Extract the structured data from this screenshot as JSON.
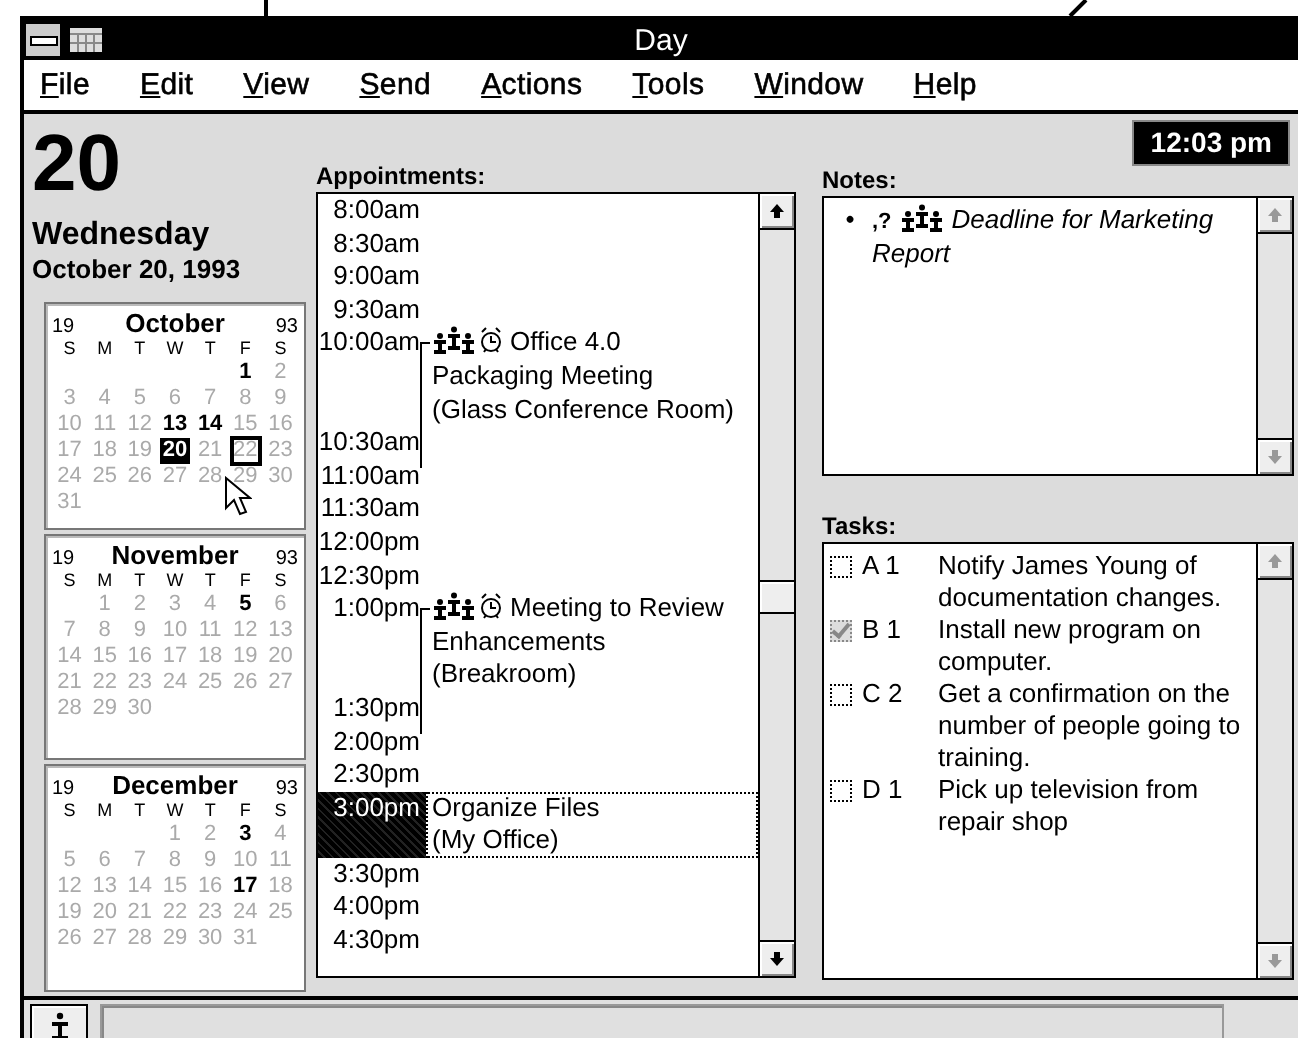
{
  "window": {
    "title": "Day"
  },
  "menu": [
    {
      "label": "File"
    },
    {
      "label": "Edit"
    },
    {
      "label": "View"
    },
    {
      "label": "Send"
    },
    {
      "label": "Actions"
    },
    {
      "label": "Tools"
    },
    {
      "label": "Window"
    },
    {
      "label": "Help"
    }
  ],
  "date": {
    "day": "20",
    "weekday": "Wednesday",
    "full": "October 20, 1993"
  },
  "clock": "12:03 pm",
  "calendars": [
    {
      "century": "19",
      "month": "October",
      "year": "93",
      "weekdays": [
        "S",
        "M",
        "T",
        "W",
        "T",
        "F",
        "S"
      ],
      "days": [
        {
          "kind": "blank"
        },
        {
          "kind": "blank"
        },
        {
          "kind": "blank"
        },
        {
          "kind": "blank"
        },
        {
          "kind": "blank"
        },
        {
          "kind": "day",
          "day": "1",
          "bold": true,
          "selected": false,
          "focused": false
        },
        {
          "kind": "day",
          "day": "2",
          "bold": false,
          "selected": false,
          "focused": false
        },
        {
          "kind": "day",
          "day": "3",
          "bold": false,
          "selected": false,
          "focused": false
        },
        {
          "kind": "day",
          "day": "4",
          "bold": false,
          "selected": false,
          "focused": false
        },
        {
          "kind": "day",
          "day": "5",
          "bold": false,
          "selected": false,
          "focused": false
        },
        {
          "kind": "day",
          "day": "6",
          "bold": false,
          "selected": false,
          "focused": false
        },
        {
          "kind": "day",
          "day": "7",
          "bold": false,
          "selected": false,
          "focused": false
        },
        {
          "kind": "day",
          "day": "8",
          "bold": false,
          "selected": false,
          "focused": false
        },
        {
          "kind": "day",
          "day": "9",
          "bold": false,
          "selected": false,
          "focused": false
        },
        {
          "kind": "day",
          "day": "10",
          "bold": false,
          "selected": false,
          "focused": false
        },
        {
          "kind": "day",
          "day": "11",
          "bold": false,
          "selected": false,
          "focused": false
        },
        {
          "kind": "day",
          "day": "12",
          "bold": false,
          "selected": false,
          "focused": false
        },
        {
          "kind": "day",
          "day": "13",
          "bold": true,
          "selected": false,
          "focused": false
        },
        {
          "kind": "day",
          "day": "14",
          "bold": true,
          "selected": false,
          "focused": false
        },
        {
          "kind": "day",
          "day": "15",
          "bold": false,
          "selected": false,
          "focused": false
        },
        {
          "kind": "day",
          "day": "16",
          "bold": false,
          "selected": false,
          "focused": false
        },
        {
          "kind": "day",
          "day": "17",
          "bold": false,
          "selected": false,
          "focused": false
        },
        {
          "kind": "day",
          "day": "18",
          "bold": false,
          "selected": false,
          "focused": false
        },
        {
          "kind": "day",
          "day": "19",
          "bold": false,
          "selected": false,
          "focused": false
        },
        {
          "kind": "day",
          "day": "20",
          "bold": true,
          "selected": true,
          "focused": false
        },
        {
          "kind": "day",
          "day": "21",
          "bold": false,
          "selected": false,
          "focused": false
        },
        {
          "kind": "day",
          "day": "22",
          "bold": false,
          "selected": false,
          "focused": true
        },
        {
          "kind": "day",
          "day": "23",
          "bold": false,
          "selected": false,
          "focused": false
        },
        {
          "kind": "day",
          "day": "24",
          "bold": false,
          "selected": false,
          "focused": false
        },
        {
          "kind": "day",
          "day": "25",
          "bold": false,
          "selected": false,
          "focused": false
        },
        {
          "kind": "day",
          "day": "26",
          "bold": false,
          "selected": false,
          "focused": false
        },
        {
          "kind": "day",
          "day": "27",
          "bold": false,
          "selected": false,
          "focused": false
        },
        {
          "kind": "day",
          "day": "28",
          "bold": false,
          "selected": false,
          "focused": false
        },
        {
          "kind": "day",
          "day": "29",
          "bold": false,
          "selected": false,
          "focused": false
        },
        {
          "kind": "day",
          "day": "30",
          "bold": false,
          "selected": false,
          "focused": false
        },
        {
          "kind": "day",
          "day": "31",
          "bold": false,
          "selected": false,
          "focused": false
        }
      ]
    },
    {
      "century": "19",
      "month": "November",
      "year": "93",
      "weekdays": [
        "S",
        "M",
        "T",
        "W",
        "T",
        "F",
        "S"
      ],
      "days": [
        {
          "kind": "blank"
        },
        {
          "kind": "day",
          "day": "1",
          "bold": false,
          "selected": false,
          "focused": false
        },
        {
          "kind": "day",
          "day": "2",
          "bold": false,
          "selected": false,
          "focused": false
        },
        {
          "kind": "day",
          "day": "3",
          "bold": false,
          "selected": false,
          "focused": false
        },
        {
          "kind": "day",
          "day": "4",
          "bold": false,
          "selected": false,
          "focused": false
        },
        {
          "kind": "day",
          "day": "5",
          "bold": true,
          "selected": false,
          "focused": false
        },
        {
          "kind": "day",
          "day": "6",
          "bold": false,
          "selected": false,
          "focused": false
        },
        {
          "kind": "day",
          "day": "7",
          "bold": false,
          "selected": false,
          "focused": false
        },
        {
          "kind": "day",
          "day": "8",
          "bold": false,
          "selected": false,
          "focused": false
        },
        {
          "kind": "day",
          "day": "9",
          "bold": false,
          "selected": false,
          "focused": false
        },
        {
          "kind": "day",
          "day": "10",
          "bold": false,
          "selected": false,
          "focused": false
        },
        {
          "kind": "day",
          "day": "11",
          "bold": false,
          "selected": false,
          "focused": false
        },
        {
          "kind": "day",
          "day": "12",
          "bold": false,
          "selected": false,
          "focused": false
        },
        {
          "kind": "day",
          "day": "13",
          "bold": false,
          "selected": false,
          "focused": false
        },
        {
          "kind": "day",
          "day": "14",
          "bold": false,
          "selected": false,
          "focused": false
        },
        {
          "kind": "day",
          "day": "15",
          "bold": false,
          "selected": false,
          "focused": false
        },
        {
          "kind": "day",
          "day": "16",
          "bold": false,
          "selected": false,
          "focused": false
        },
        {
          "kind": "day",
          "day": "17",
          "bold": false,
          "selected": false,
          "focused": false
        },
        {
          "kind": "day",
          "day": "18",
          "bold": false,
          "selected": false,
          "focused": false
        },
        {
          "kind": "day",
          "day": "19",
          "bold": false,
          "selected": false,
          "focused": false
        },
        {
          "kind": "day",
          "day": "20",
          "bold": false,
          "selected": false,
          "focused": false
        },
        {
          "kind": "day",
          "day": "21",
          "bold": false,
          "selected": false,
          "focused": false
        },
        {
          "kind": "day",
          "day": "22",
          "bold": false,
          "selected": false,
          "focused": false
        },
        {
          "kind": "day",
          "day": "23",
          "bold": false,
          "selected": false,
          "focused": false
        },
        {
          "kind": "day",
          "day": "24",
          "bold": false,
          "selected": false,
          "focused": false
        },
        {
          "kind": "day",
          "day": "25",
          "bold": false,
          "selected": false,
          "focused": false
        },
        {
          "kind": "day",
          "day": "26",
          "bold": false,
          "selected": false,
          "focused": false
        },
        {
          "kind": "day",
          "day": "27",
          "bold": false,
          "selected": false,
          "focused": false
        },
        {
          "kind": "day",
          "day": "28",
          "bold": false,
          "selected": false,
          "focused": false
        },
        {
          "kind": "day",
          "day": "29",
          "bold": false,
          "selected": false,
          "focused": false
        },
        {
          "kind": "day",
          "day": "30",
          "bold": false,
          "selected": false,
          "focused": false
        }
      ]
    },
    {
      "century": "19",
      "month": "December",
      "year": "93",
      "weekdays": [
        "S",
        "M",
        "T",
        "W",
        "T",
        "F",
        "S"
      ],
      "days": [
        {
          "kind": "blank"
        },
        {
          "kind": "blank"
        },
        {
          "kind": "blank"
        },
        {
          "kind": "day",
          "day": "1",
          "bold": false,
          "selected": false,
          "focused": false
        },
        {
          "kind": "day",
          "day": "2",
          "bold": false,
          "selected": false,
          "focused": false
        },
        {
          "kind": "day",
          "day": "3",
          "bold": true,
          "selected": false,
          "focused": false
        },
        {
          "kind": "day",
          "day": "4",
          "bold": false,
          "selected": false,
          "focused": false
        },
        {
          "kind": "day",
          "day": "5",
          "bold": false,
          "selected": false,
          "focused": false
        },
        {
          "kind": "day",
          "day": "6",
          "bold": false,
          "selected": false,
          "focused": false
        },
        {
          "kind": "day",
          "day": "7",
          "bold": false,
          "selected": false,
          "focused": false
        },
        {
          "kind": "day",
          "day": "8",
          "bold": false,
          "selected": false,
          "focused": false
        },
        {
          "kind": "day",
          "day": "9",
          "bold": false,
          "selected": false,
          "focused": false
        },
        {
          "kind": "day",
          "day": "10",
          "bold": false,
          "selected": false,
          "focused": false
        },
        {
          "kind": "day",
          "day": "11",
          "bold": false,
          "selected": false,
          "focused": false
        },
        {
          "kind": "day",
          "day": "12",
          "bold": false,
          "selected": false,
          "focused": false
        },
        {
          "kind": "day",
          "day": "13",
          "bold": false,
          "selected": false,
          "focused": false
        },
        {
          "kind": "day",
          "day": "14",
          "bold": false,
          "selected": false,
          "focused": false
        },
        {
          "kind": "day",
          "day": "15",
          "bold": false,
          "selected": false,
          "focused": false
        },
        {
          "kind": "day",
          "day": "16",
          "bold": false,
          "selected": false,
          "focused": false
        },
        {
          "kind": "day",
          "day": "17",
          "bold": true,
          "selected": false,
          "focused": false
        },
        {
          "kind": "day",
          "day": "18",
          "bold": false,
          "selected": false,
          "focused": false
        },
        {
          "kind": "day",
          "day": "19",
          "bold": false,
          "selected": false,
          "focused": false
        },
        {
          "kind": "day",
          "day": "20",
          "bold": false,
          "selected": false,
          "focused": false
        },
        {
          "kind": "day",
          "day": "21",
          "bold": false,
          "selected": false,
          "focused": false
        },
        {
          "kind": "day",
          "day": "22",
          "bold": false,
          "selected": false,
          "focused": false
        },
        {
          "kind": "day",
          "day": "23",
          "bold": false,
          "selected": false,
          "focused": false
        },
        {
          "kind": "day",
          "day": "24",
          "bold": false,
          "selected": false,
          "focused": false
        },
        {
          "kind": "day",
          "day": "25",
          "bold": false,
          "selected": false,
          "focused": false
        },
        {
          "kind": "day",
          "day": "26",
          "bold": false,
          "selected": false,
          "focused": false
        },
        {
          "kind": "day",
          "day": "27",
          "bold": false,
          "selected": false,
          "focused": false
        },
        {
          "kind": "day",
          "day": "28",
          "bold": false,
          "selected": false,
          "focused": false
        },
        {
          "kind": "day",
          "day": "29",
          "bold": false,
          "selected": false,
          "focused": false
        },
        {
          "kind": "day",
          "day": "30",
          "bold": false,
          "selected": false,
          "focused": false
        },
        {
          "kind": "day",
          "day": "31",
          "bold": false,
          "selected": false,
          "focused": false
        }
      ]
    }
  ],
  "appointments": {
    "label": "Appointments:",
    "rows": [
      {
        "time": "8:00am",
        "selected": false
      },
      {
        "time": "8:30am",
        "selected": false
      },
      {
        "time": "9:00am",
        "selected": false
      },
      {
        "time": "9:30am",
        "selected": false
      },
      {
        "time": "10:00am",
        "selected": false,
        "entry": {
          "kind": "meeting",
          "lines": [
            "Office 4.0",
            "Packaging Meeting",
            "(Glass Conference Room)"
          ]
        }
      },
      {
        "time": "10:30am",
        "selected": false
      },
      {
        "time": "11:00am",
        "selected": false
      },
      {
        "time": "11:30am",
        "selected": false
      },
      {
        "time": "12:00pm",
        "selected": false
      },
      {
        "time": "12:30pm",
        "selected": false
      },
      {
        "time": "1:00pm",
        "selected": false,
        "entry": {
          "kind": "meeting",
          "lines": [
            "Meeting to Review",
            "Enhancements",
            "(Breakroom)"
          ]
        }
      },
      {
        "time": "1:30pm",
        "selected": false
      },
      {
        "time": "2:00pm",
        "selected": false
      },
      {
        "time": "2:30pm",
        "selected": false
      },
      {
        "time": "3:00pm",
        "selected": true,
        "entry": {
          "kind": "plain",
          "lines": [
            "Organize Files",
            "(My Office)"
          ]
        }
      },
      {
        "time": "3:30pm",
        "selected": false
      },
      {
        "time": "4:00pm",
        "selected": false
      },
      {
        "time": "4:30pm",
        "selected": false
      }
    ]
  },
  "notes": {
    "label": "Notes:",
    "items": [
      {
        "bullet": "•",
        "marker": ",?",
        "lines": [
          "Deadline for Marketing",
          "Report"
        ]
      }
    ]
  },
  "tasks": {
    "label": "Tasks:",
    "items": [
      {
        "checked": false,
        "priority": "A 1",
        "text": "Notify James Young of documentation changes."
      },
      {
        "checked": true,
        "priority": "B 1",
        "text": "Install new program on computer."
      },
      {
        "checked": false,
        "priority": "C 2",
        "text": "Get a confirmation on the number of people going to training."
      },
      {
        "checked": false,
        "priority": "D 1",
        "text": "Pick up television from repair shop"
      }
    ]
  }
}
